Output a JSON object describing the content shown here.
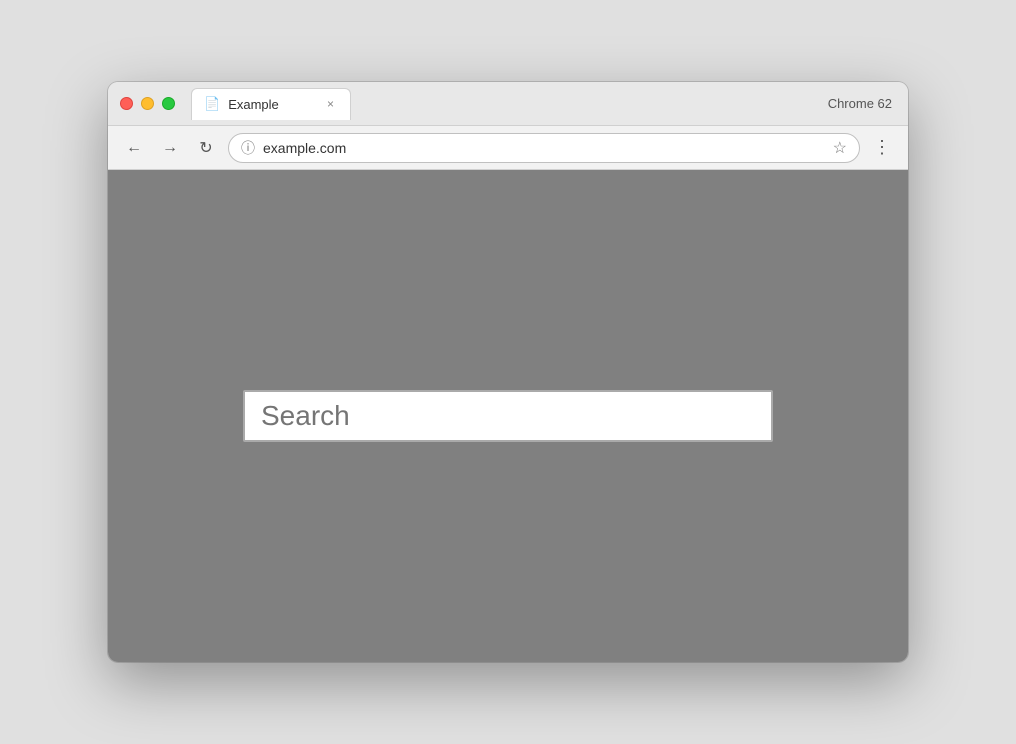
{
  "browser": {
    "chrome_version": "Chrome 62",
    "tab": {
      "title": "Example",
      "icon": "📄",
      "close_btn": "×"
    },
    "nav": {
      "back_btn": "←",
      "forward_btn": "→",
      "reload_btn": "↻",
      "url": "example.com",
      "info_icon": "ⓘ",
      "star_icon": "☆",
      "menu_icon": "⋮"
    }
  },
  "page": {
    "search_placeholder": "Search"
  }
}
